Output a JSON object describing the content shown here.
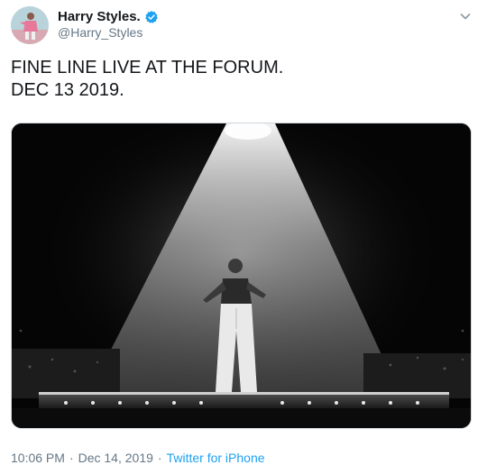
{
  "author": {
    "display_name": "Harry Styles.",
    "handle": "@Harry_Styles",
    "verified": true,
    "verified_color": "#1da1f2"
  },
  "tweet": {
    "text": "FINE LINE LIVE AT THE FORUM.\nDEC 13 2019."
  },
  "media": {
    "type": "photo",
    "style": "black-and-white"
  },
  "meta": {
    "time": "10:06 PM",
    "separator": "·",
    "date": "Dec 14, 2019",
    "source": "Twitter for iPhone"
  },
  "icons": {
    "more": "chevron-down-icon",
    "verified": "verified-badge-icon"
  }
}
